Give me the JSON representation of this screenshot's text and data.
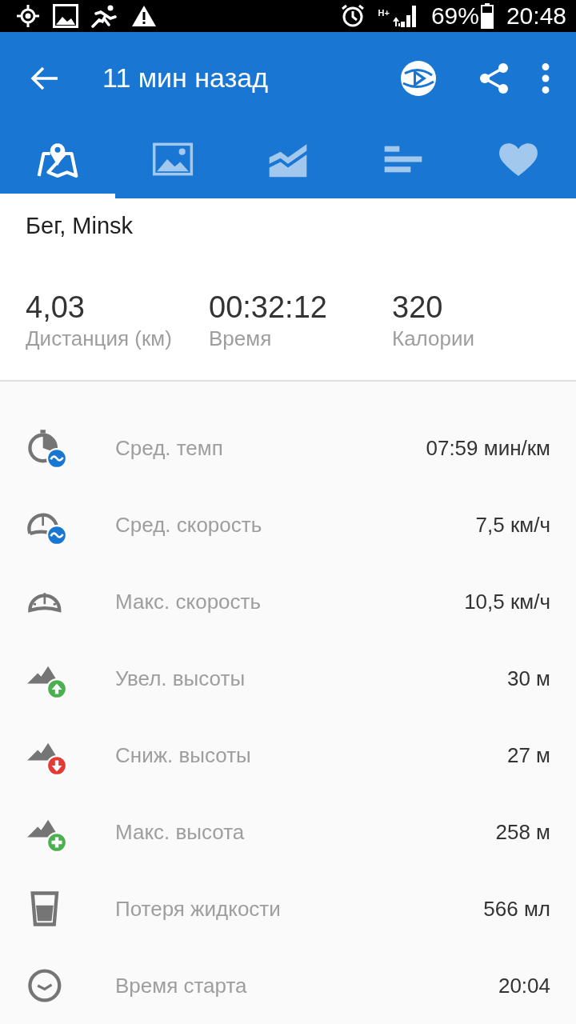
{
  "status_bar": {
    "network": "H+",
    "battery": "69%",
    "time": "20:48"
  },
  "toolbar": {
    "title": "11 мин назад"
  },
  "tabs": [
    {
      "kind": "map",
      "selected": true
    },
    {
      "kind": "photos",
      "selected": false
    },
    {
      "kind": "chart",
      "selected": false
    },
    {
      "kind": "splits",
      "selected": false
    },
    {
      "kind": "heart",
      "selected": false
    }
  ],
  "activity": {
    "title": "Бег, Minsk"
  },
  "summary": [
    {
      "value": "4,03",
      "label": "Дистанция (км)"
    },
    {
      "value": "00:32:12",
      "label": "Время"
    },
    {
      "value": "320",
      "label": "Калории"
    }
  ],
  "stats": [
    {
      "kind": "pace",
      "label": "Сред. темп",
      "value": "07:59 мин/км"
    },
    {
      "kind": "avg-speed",
      "label": "Сред. скорость",
      "value": "7,5 км/ч"
    },
    {
      "kind": "max-speed",
      "label": "Макс. скорость",
      "value": "10,5 км/ч"
    },
    {
      "kind": "ascent",
      "label": "Увел. высоты",
      "value": "30 м"
    },
    {
      "kind": "descent",
      "label": "Сниж. высоты",
      "value": "27 м"
    },
    {
      "kind": "max-altitude",
      "label": "Макс. высота",
      "value": "258 м"
    },
    {
      "kind": "fluid",
      "label": "Потеря жидкости",
      "value": "566 мл"
    },
    {
      "kind": "start-time",
      "label": "Время старта",
      "value": "20:04"
    }
  ]
}
